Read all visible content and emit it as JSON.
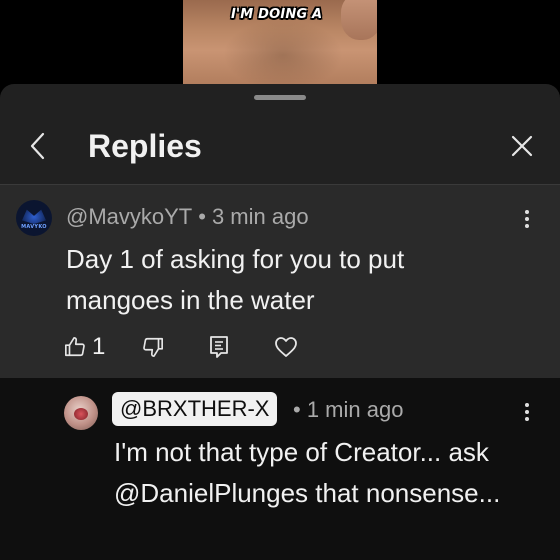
{
  "video": {
    "caption": "I'M DOING A"
  },
  "header": {
    "title": "Replies",
    "back_icon": "chevron-left-icon",
    "close_icon": "close-icon"
  },
  "parent_comment": {
    "author": "@MavykoYT",
    "separator": "•",
    "time": "3 min ago",
    "text": "Day 1 of asking for you to put mangoes in the water",
    "like_count": "1",
    "avatar_text": "MAVYKO"
  },
  "reply": {
    "mention": "@BRXTHER-X",
    "separator": "•",
    "time": "1 min ago",
    "text": "I'm not that type of Creator... ask @DanielPlunges that nonsense..."
  },
  "colors": {
    "sheet_bg": "#212121",
    "highlight_bg": "#2a2a2a",
    "reply_bg": "#0f0f0f",
    "text_primary": "#f1f1f1",
    "text_secondary": "#aaaaaa"
  }
}
